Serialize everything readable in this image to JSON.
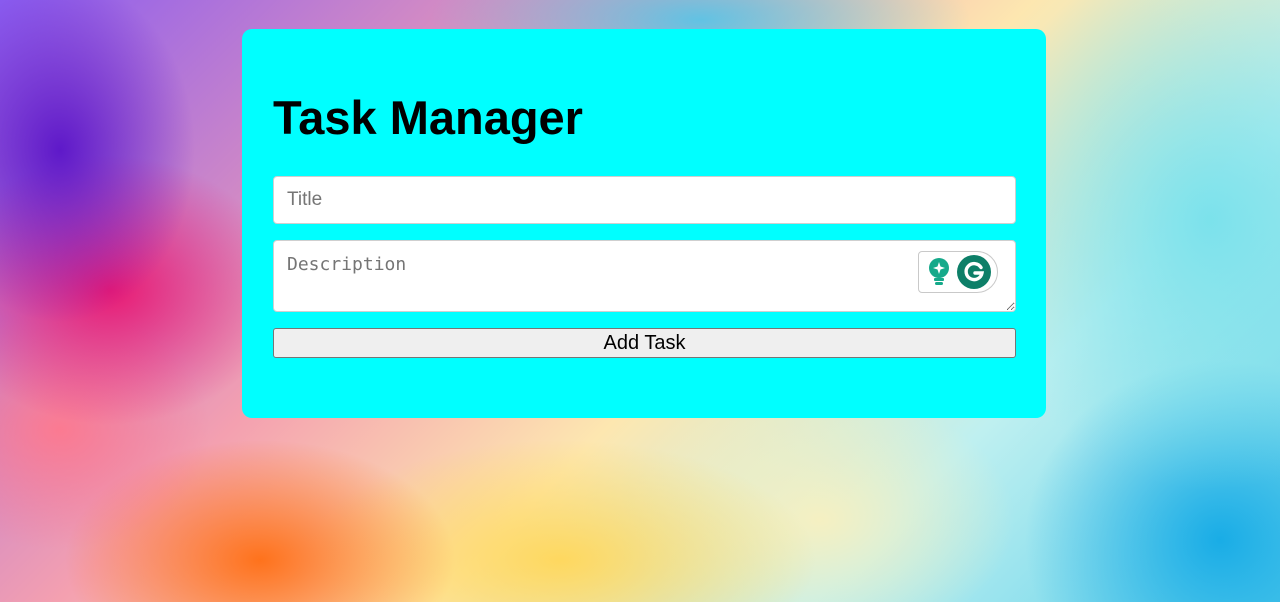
{
  "app": {
    "title": "Task Manager"
  },
  "form": {
    "title_placeholder": "Title",
    "title_value": "",
    "description_placeholder": "Description",
    "description_value": "",
    "add_button_label": "Add Task"
  },
  "extensions": {
    "grammarly": {
      "icons": [
        "lightbulb-icon",
        "grammarly-logo-icon"
      ]
    }
  },
  "colors": {
    "card_background": "#00ffff",
    "button_background": "#efefef",
    "grammarly_green": "#15a98a"
  }
}
